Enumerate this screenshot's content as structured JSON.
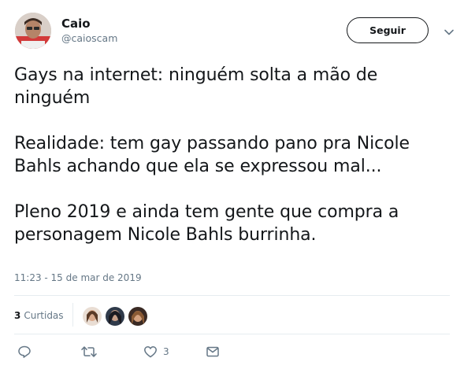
{
  "author": {
    "name": "Caio",
    "handle": "@caioscam"
  },
  "follow_button": "Seguir",
  "tweet": {
    "paragraphs": [
      "Gays na internet: ninguém solta a mão de\nninguém",
      "Realidade: tem gay passando pano pra Nicole\nBahls achando que ela se expressou mal...",
      "Pleno 2019 e ainda tem gente que compra a\npersonagem Nicole Bahls burrinha."
    ],
    "timestamp": "11:23 - 15 de mar de 2019"
  },
  "stats": {
    "likes_count": "3",
    "likes_label": "Curtidas"
  },
  "actions": {
    "like_count": "3"
  },
  "icons": {
    "reply": "reply-icon",
    "retweet": "retweet-icon",
    "like": "heart-icon",
    "dm": "envelope-icon",
    "caret": "chevron-down-icon"
  },
  "colors": {
    "text": "#14171a",
    "secondary": "#657786",
    "divider": "#e6ecf0"
  }
}
